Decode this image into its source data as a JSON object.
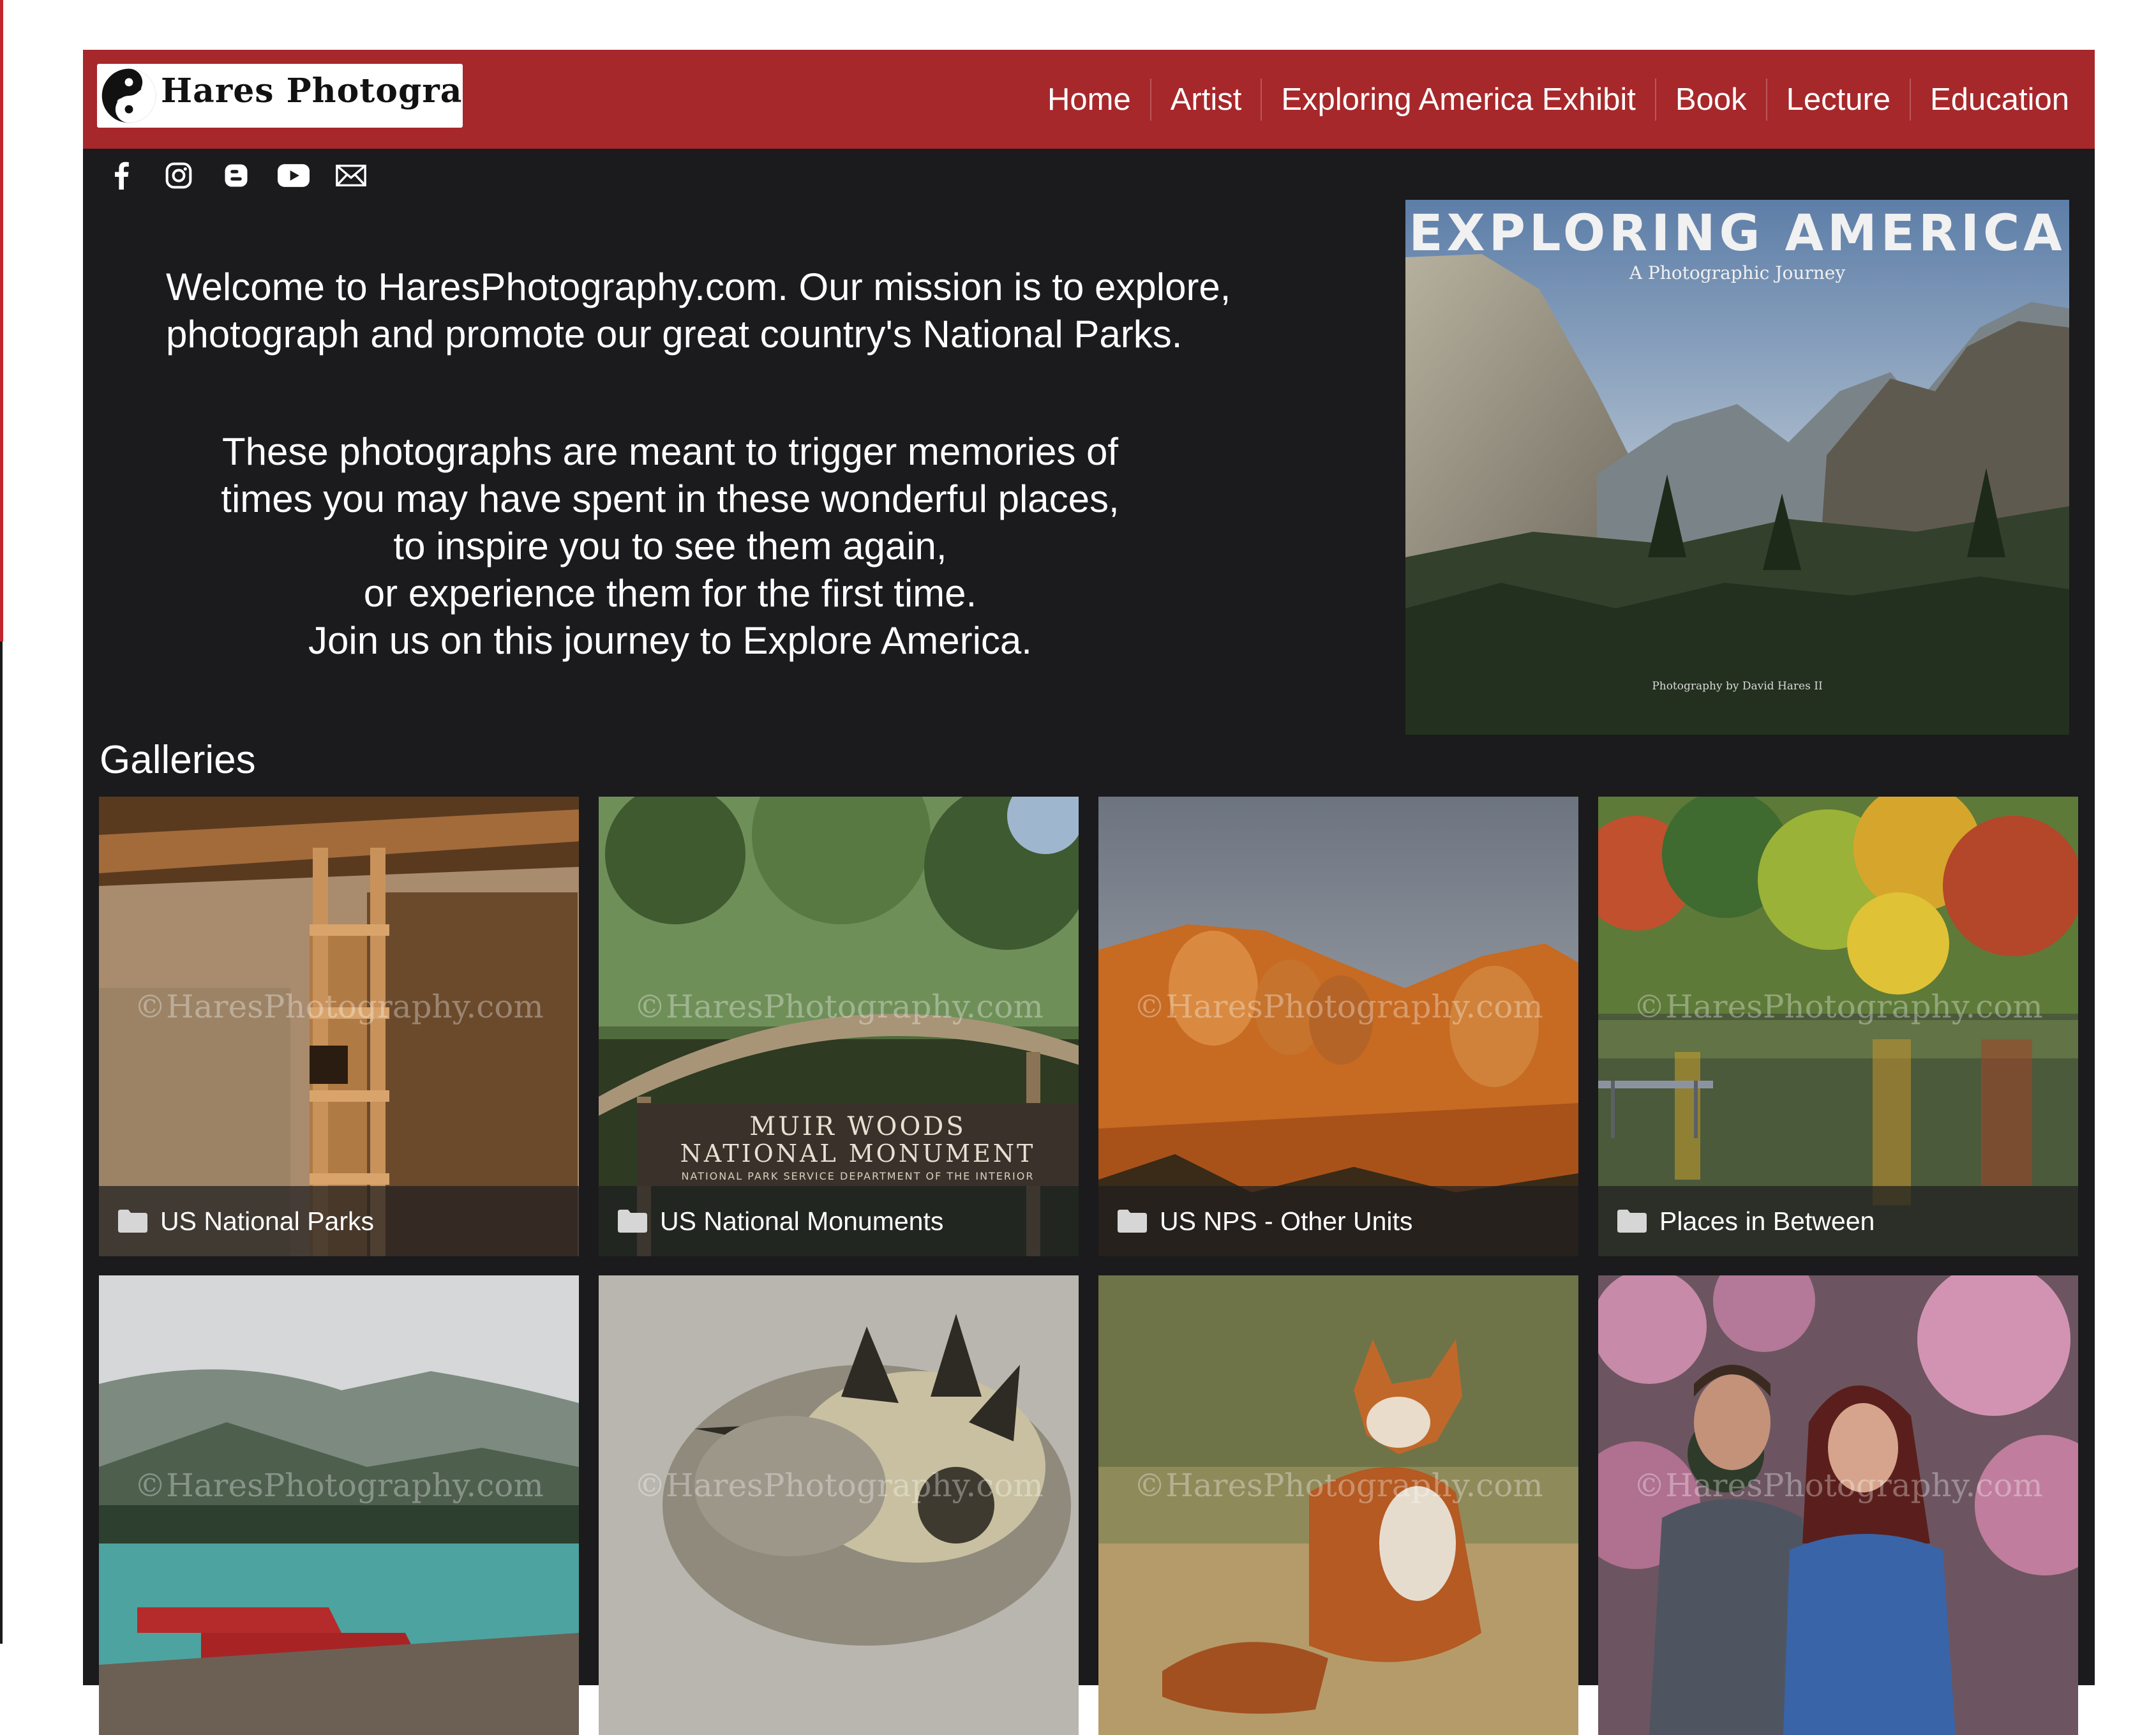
{
  "header": {
    "logo_text": "Hares Photography",
    "nav": [
      "Home",
      "Artist",
      "Exploring America Exhibit",
      "Book",
      "Lecture",
      "Education"
    ]
  },
  "social": [
    "facebook-icon",
    "instagram-icon",
    "blogger-icon",
    "youtube-icon",
    "email-icon"
  ],
  "intro": {
    "mission": [
      "Welcome to HaresPhotography.com.  Our mission is to explore,",
      "photograph and promote our great country's National Parks."
    ],
    "journey": [
      "These photographs are meant to trigger memories of",
      "times you may have spent in these wonderful places,",
      "to inspire you to see them again,",
      "or experience them for the first time.",
      "Join us on this journey to Explore America."
    ]
  },
  "book_cover": {
    "title": "EXPLORING AMERICA",
    "subtitle": "A Photographic Journey",
    "credit": "Photography by David Hares II"
  },
  "galleries": {
    "heading": "Galleries",
    "watermark": "©HaresPhotography.com",
    "tiles": [
      {
        "label": "US National Parks"
      },
      {
        "label": "US National Monuments",
        "sign_line1": "MUIR WOODS",
        "sign_line2": "NATIONAL MONUMENT",
        "sign_line3": "NATIONAL PARK SERVICE DEPARTMENT OF THE INTERIOR"
      },
      {
        "label": "US NPS - Other Units"
      },
      {
        "label": "Places in Between"
      },
      {
        "label": ""
      },
      {
        "label": ""
      },
      {
        "label": ""
      },
      {
        "label": ""
      }
    ]
  },
  "colors": {
    "header_red": "#a6282b",
    "panel_dark": "#1b1a1c"
  }
}
